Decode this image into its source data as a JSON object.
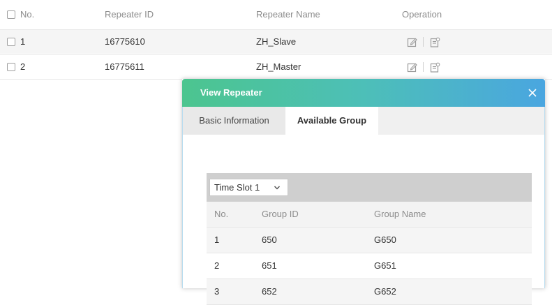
{
  "table": {
    "header": {
      "no": "No.",
      "repeater_id": "Repeater ID",
      "repeater_name": "Repeater Name",
      "operation": "Operation"
    },
    "rows": [
      {
        "no": "1",
        "repeater_id": "16775610",
        "repeater_name": "ZH_Slave"
      },
      {
        "no": "2",
        "repeater_id": "16775611",
        "repeater_name": "ZH_Master"
      }
    ]
  },
  "modal": {
    "title": "View Repeater",
    "tabs": [
      {
        "label": "Basic Information"
      },
      {
        "label": "Available Group"
      }
    ],
    "active_tab": "Available Group",
    "time_slot_select": {
      "selected": "Time Slot 1"
    },
    "group_table": {
      "header": {
        "no": "No.",
        "group_id": "Group ID",
        "group_name": "Group Name"
      },
      "rows": [
        {
          "no": "1",
          "group_id": "650",
          "group_name": "G650"
        },
        {
          "no": "2",
          "group_id": "651",
          "group_name": "G651"
        },
        {
          "no": "3",
          "group_id": "652",
          "group_name": "G652"
        }
      ]
    }
  },
  "icons": {
    "edit": "edit-icon",
    "details": "details-icon",
    "close": "close-icon",
    "chevron": "chevron-down-icon"
  },
  "colors": {
    "header_gradient_start": "#4cc58f",
    "header_gradient_end": "#4aa6e0",
    "row_alt": "#f5f5f5",
    "toolbar_bg": "#cfcfcf"
  }
}
